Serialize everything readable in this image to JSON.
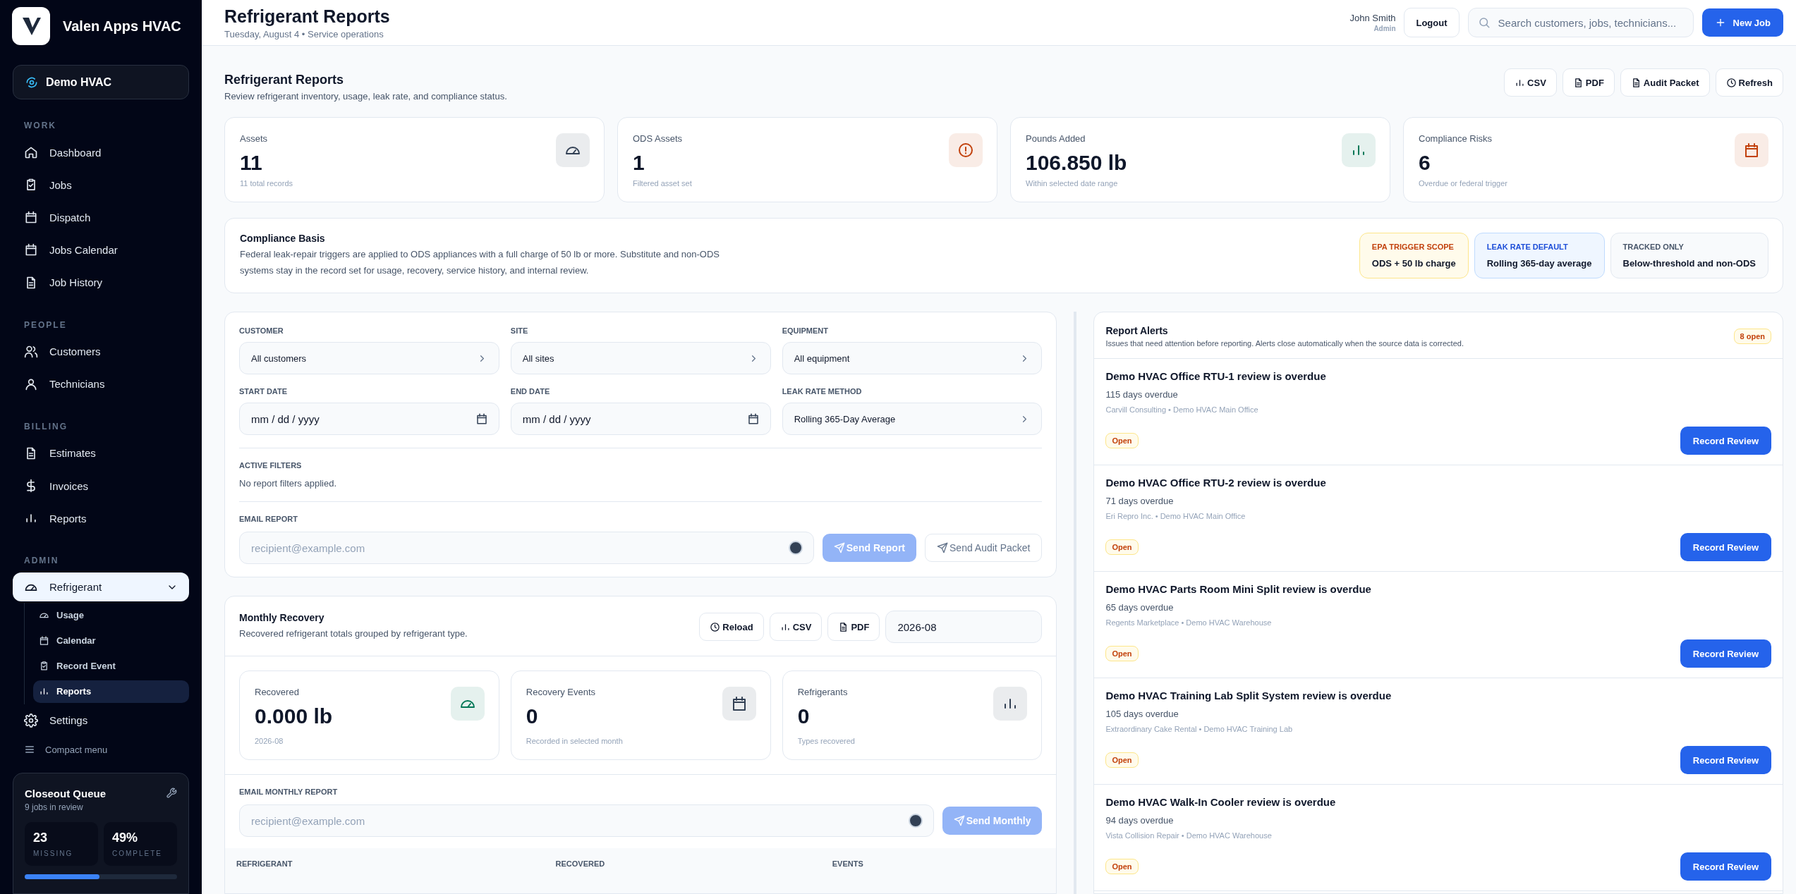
{
  "sidebar": {
    "brand": "Valen Apps HVAC",
    "workspace": "Demo HVAC",
    "nav": [
      {
        "heading": "WORK",
        "items": [
          {
            "label": "Dashboard",
            "kind": "home",
            "selected": false
          },
          {
            "label": "Jobs",
            "kind": "clipboard",
            "selected": false
          },
          {
            "label": "Dispatch",
            "kind": "calendar",
            "selected": false
          },
          {
            "label": "Jobs Calendar",
            "kind": "calendar",
            "selected": false
          },
          {
            "label": "Job History",
            "kind": "file",
            "selected": false
          }
        ]
      },
      {
        "heading": "PEOPLE",
        "items": [
          {
            "label": "Customers",
            "kind": "users",
            "selected": false
          },
          {
            "label": "Technicians",
            "kind": "user",
            "selected": false
          }
        ]
      },
      {
        "heading": "BILLING",
        "items": [
          {
            "label": "Estimates",
            "kind": "file",
            "selected": false
          },
          {
            "label": "Invoices",
            "kind": "dollar",
            "selected": false
          },
          {
            "label": "Reports",
            "kind": "bars",
            "selected": false
          }
        ]
      },
      {
        "heading": "ADMIN",
        "items": [
          {
            "label": "Refrigerant",
            "kind": "gauge",
            "selected": true,
            "expanded": true,
            "children": [
              {
                "label": "Usage",
                "kind": "gauge",
                "selected": false
              },
              {
                "label": "Calendar",
                "kind": "calendar",
                "selected": false
              },
              {
                "label": "Record Event",
                "kind": "clipboard",
                "selected": false
              },
              {
                "label": "Reports",
                "kind": "bars",
                "selected": true
              }
            ]
          }
        ]
      }
    ],
    "footer_items": [
      {
        "label": "Settings",
        "kind": "gear"
      },
      {
        "label": "Compact menu",
        "kind": "menu"
      }
    ],
    "queue": {
      "title": "Closeout Queue",
      "subtitle": "9 jobs in review",
      "stats": [
        {
          "value": "23",
          "label": "MISSING"
        },
        {
          "value": "49%",
          "label": "COMPLETE"
        }
      ],
      "level": 0.49
    }
  },
  "header": {
    "title": "Refrigerant Reports",
    "subtitle": "Tuesday, August 4 • Service operations",
    "user": "John Smith",
    "role": "Admin",
    "logout": "Logout",
    "search": {
      "placeholder": "Search customers, jobs, technicians..."
    },
    "new_job": "New Job"
  },
  "page": {
    "title": "Refrigerant Reports",
    "subtitle": "Review refrigerant inventory, usage, leak rate, and compliance status.",
    "actions": [
      {
        "label": "CSV",
        "kind": "bars"
      },
      {
        "label": "PDF",
        "kind": "file"
      },
      {
        "label": "Audit Packet",
        "kind": "file"
      },
      {
        "label": "Refresh",
        "kind": "clock"
      }
    ],
    "stats": [
      {
        "label": "Assets",
        "value": "11",
        "note": "11 total records",
        "kind": "gauge",
        "color": "#334155"
      },
      {
        "label": "ODS Assets",
        "value": "1",
        "note": "Filtered asset set",
        "kind": "alert",
        "color": "#c2410c"
      },
      {
        "label": "Pounds Added",
        "value": "106.850 lb",
        "note": "Within selected date range",
        "kind": "bars",
        "color": "#047857"
      },
      {
        "label": "Compliance Risks",
        "value": "6",
        "note": "Overdue or federal trigger",
        "kind": "calendar",
        "color": "#c2410c"
      }
    ],
    "compliance": {
      "title": "Compliance Basis",
      "text": "Federal leak-repair triggers are applied to ODS appliances with a full charge of 50 lb or more. Substitute and non-ODS systems stay in the record set for usage, recovery, service history, and internal review.",
      "tags": [
        {
          "title": "EPA TRIGGER SCOPE",
          "value": "ODS + 50 lb charge",
          "kind": "amber"
        },
        {
          "title": "LEAK RATE DEFAULT",
          "value": "Rolling 365-day average",
          "kind": "blue"
        },
        {
          "title": "TRACKED ONLY",
          "value": "Below-threshold and non-ODS",
          "kind": "slate"
        }
      ]
    }
  },
  "filters": {
    "fields": [
      {
        "label": "CUSTOMER",
        "kind": "select",
        "value": "All customers"
      },
      {
        "label": "SITE",
        "kind": "select",
        "value": "All sites"
      },
      {
        "label": "EQUIPMENT",
        "kind": "select",
        "value": "All equipment"
      },
      {
        "label": "START DATE",
        "kind": "date",
        "placeholder": "mm / dd / yyyy"
      },
      {
        "label": "END DATE",
        "kind": "date",
        "placeholder": "mm / dd / yyyy"
      },
      {
        "label": "LEAK RATE METHOD",
        "kind": "select",
        "value": "Rolling 365-Day Average"
      }
    ],
    "active_label": "ACTIVE FILTERS",
    "active_text": "No report filters applied.",
    "email": {
      "label": "EMAIL REPORT",
      "placeholder": "recipient@example.com",
      "buttons": [
        {
          "label": "Send Report",
          "kind": "primary",
          "disabled": true
        },
        {
          "label": "Send Audit Packet",
          "kind": "outline",
          "disabled": true
        }
      ]
    }
  },
  "monthly": {
    "title": "Monthly Recovery",
    "subtitle": "Recovered refrigerant totals grouped by refrigerant type.",
    "actions": [
      {
        "label": "Reload",
        "kind": "clock"
      },
      {
        "label": "CSV",
        "kind": "bars"
      },
      {
        "label": "PDF",
        "kind": "file"
      }
    ],
    "month": "2026-08",
    "stats": [
      {
        "label": "Recovered",
        "value": "0.000 lb",
        "note": "2026-08",
        "kind": "gauge",
        "color": "#047857"
      },
      {
        "label": "Recovery Events",
        "value": "0",
        "note": "Recorded in selected month",
        "kind": "calendar",
        "color": "#334155"
      },
      {
        "label": "Refrigerants",
        "value": "0",
        "note": "Types recovered",
        "kind": "bars",
        "color": "#334155"
      }
    ],
    "email": {
      "label": "EMAIL MONTHLY REPORT",
      "placeholder": "recipient@example.com",
      "button": {
        "label": "Send Monthly",
        "disabled": true
      }
    },
    "table": {
      "columns": [
        "REFRIGERANT",
        "RECOVERED",
        "EVENTS"
      ]
    }
  },
  "alerts": {
    "title": "Report Alerts",
    "subtitle": "Issues that need attention before reporting. Alerts close automatically when the source data is corrected.",
    "badge": "8 open",
    "items": [
      {
        "title": "Demo HVAC Office RTU-1 review is overdue",
        "days": "115 days overdue",
        "meta": "Carvill Consulting • Demo HVAC Main Office",
        "status": "Open",
        "action": "Record Review"
      },
      {
        "title": "Demo HVAC Office RTU-2 review is overdue",
        "days": "71 days overdue",
        "meta": "Eri Repro Inc. • Demo HVAC Main Office",
        "status": "Open",
        "action": "Record Review"
      },
      {
        "title": "Demo HVAC Parts Room Mini Split review is overdue",
        "days": "65 days overdue",
        "meta": "Regents Marketplace • Demo HVAC Warehouse",
        "status": "Open",
        "action": "Record Review"
      },
      {
        "title": "Demo HVAC Training Lab Split System review is overdue",
        "days": "105 days overdue",
        "meta": "Extraordinary Cake Rental • Demo HVAC Training Lab",
        "status": "Open",
        "action": "Record Review"
      },
      {
        "title": "Demo HVAC Walk-In Cooler review is overdue",
        "days": "94 days overdue",
        "meta": "Vista Collision Repair • Demo HVAC Warehouse",
        "status": "Open",
        "action": "Record Review"
      }
    ]
  }
}
